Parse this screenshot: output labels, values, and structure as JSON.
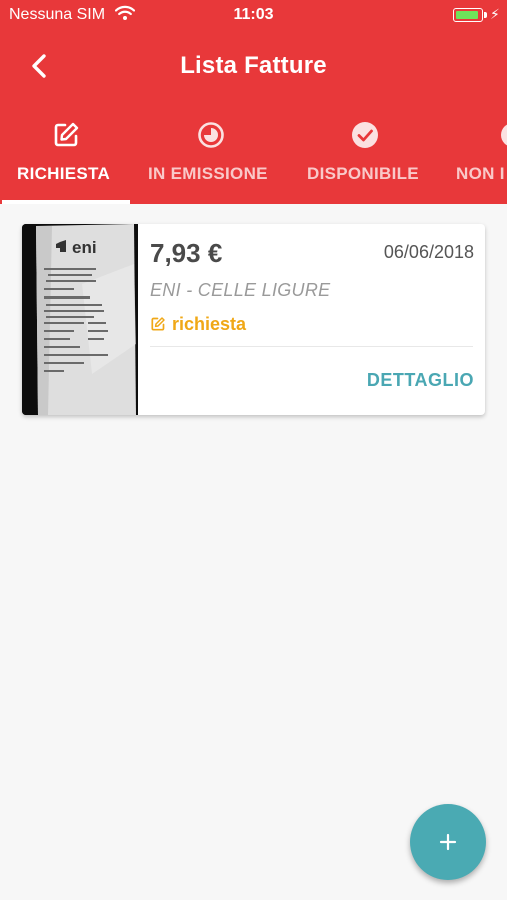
{
  "status_bar": {
    "carrier": "Nessuna SIM",
    "time": "11:03",
    "battery_level": 0.9,
    "battery_color": "#6fe35a"
  },
  "header": {
    "title": "Lista Fatture",
    "back_icon": "chevron-left-icon",
    "background": "#e8383a"
  },
  "tabs": [
    {
      "label": "RICHIESTA",
      "icon": "edit-icon",
      "active": true
    },
    {
      "label": "IN EMISSIONE",
      "icon": "clock-half-icon",
      "active": false
    },
    {
      "label": "DISPONIBILE",
      "icon": "check-circle-icon",
      "active": false
    },
    {
      "label": "NON I",
      "icon": "partial-circle-icon",
      "active": false
    }
  ],
  "invoices": [
    {
      "thumbnail_logo": "eni",
      "amount": "7,93 €",
      "date": "06/06/2018",
      "merchant": "ENI - CELLE LIGURE",
      "status": "richiesta",
      "status_icon": "edit-icon",
      "status_color": "#f0a817",
      "action": "DETTAGLIO"
    }
  ],
  "fab": {
    "label": "+",
    "icon": "plus-icon",
    "color": "#4aaab3"
  }
}
